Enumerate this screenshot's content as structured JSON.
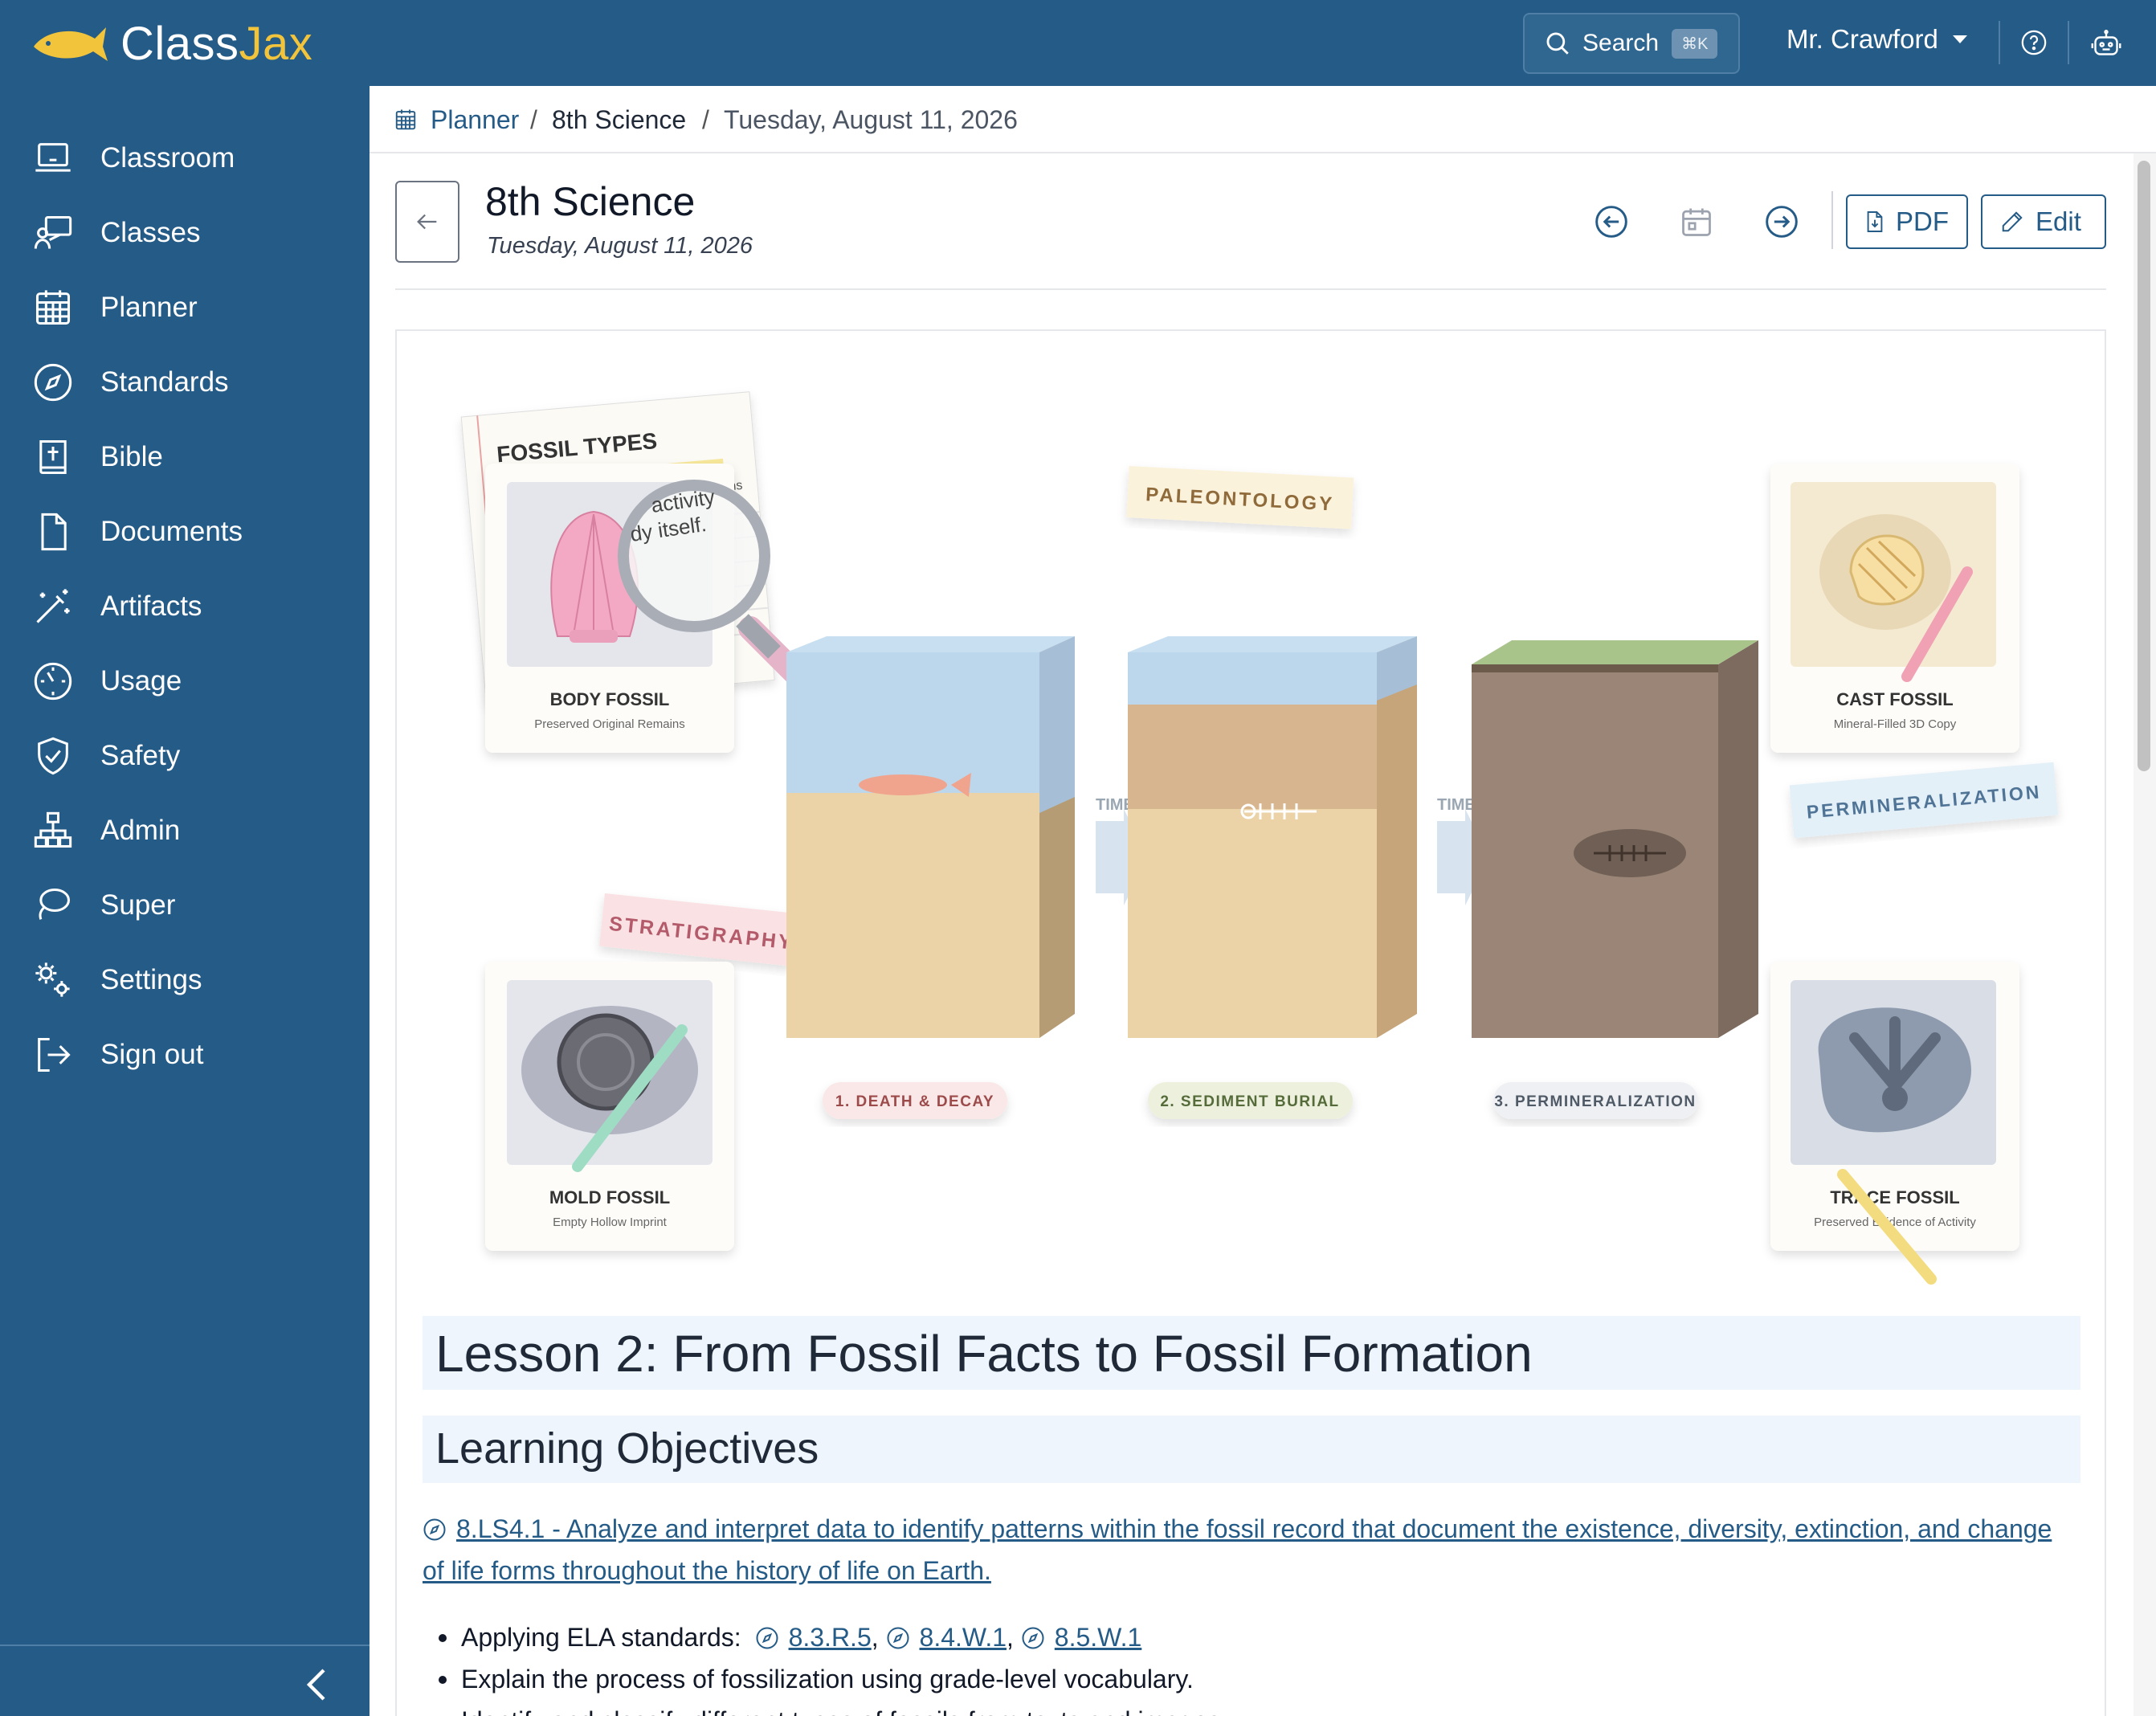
{
  "app": {
    "logo_text_main": "Class",
    "logo_text_accent": "Jax",
    "brand_color": "#255b87",
    "accent_color": "#f2c43b"
  },
  "topbar": {
    "search_label": "Search",
    "search_shortcut": "⌘K",
    "user_name": "Mr. Crawford"
  },
  "sidebar": {
    "items": [
      {
        "label": "Classroom",
        "icon": "laptop-icon"
      },
      {
        "label": "Classes",
        "icon": "teacher-board-icon"
      },
      {
        "label": "Planner",
        "icon": "calendar-grid-icon"
      },
      {
        "label": "Standards",
        "icon": "compass-icon"
      },
      {
        "label": "Bible",
        "icon": "bible-icon"
      },
      {
        "label": "Documents",
        "icon": "document-icon"
      },
      {
        "label": "Artifacts",
        "icon": "magic-wand-icon"
      },
      {
        "label": "Usage",
        "icon": "gauge-icon"
      },
      {
        "label": "Safety",
        "icon": "shield-check-icon"
      },
      {
        "label": "Admin",
        "icon": "org-chart-icon"
      },
      {
        "label": "Super",
        "icon": "lasso-icon"
      },
      {
        "label": "Settings",
        "icon": "gears-icon"
      },
      {
        "label": "Sign out",
        "icon": "sign-out-icon"
      }
    ]
  },
  "breadcrumb": {
    "root": "Planner",
    "sep1": "/",
    "class_name": "8th Science",
    "sep2": "/",
    "date": "Tuesday, August 11, 2026"
  },
  "header": {
    "title": "8th Science",
    "subtitle": "Tuesday, August 11, 2026",
    "pdf_label": "PDF",
    "edit_label": "Edit"
  },
  "illustration": {
    "note_title": "FOSSIL TYPES",
    "magnifier_text_1": "activity",
    "magnifier_text_2": "dy itself.",
    "note_side_text": "ms",
    "tag_paleontology": "PALEONTOLOGY",
    "tag_stratigraphy": "STRATIGRAPHY",
    "tag_permineralization": "PERMINERALIZATION",
    "time_label_1": "TIME",
    "time_label_2": "TIME",
    "stage_1": "1. DEATH & DECAY",
    "stage_2": "2. SEDIMENT BURIAL",
    "stage_3": "3. PERMINERALIZATION",
    "cards": {
      "body": {
        "title": "BODY FOSSIL",
        "caption": "Preserved Original Remains"
      },
      "cast": {
        "title": "CAST FOSSIL",
        "caption": "Mineral-Filled 3D Copy"
      },
      "mold": {
        "title": "MOLD FOSSIL",
        "caption": "Empty Hollow Imprint"
      },
      "trace": {
        "title": "TRACE FOSSIL",
        "caption": "Preserved Evidence of Activity"
      }
    }
  },
  "lesson": {
    "title": "Lesson 2: From Fossil Facts to Fossil Formation",
    "objectives_heading": "Learning Objectives",
    "standard_link": "8.LS4.1 - Analyze and interpret data to identify patterns within the fossil record that document the existence, diversity, extinction, and change of life forms throughout the history of life on Earth.",
    "bullet_1_prefix": "Applying ELA standards:",
    "ela_links": [
      "8.3.R.5",
      "8.4.W.1",
      "8.5.W.1"
    ],
    "bullet_2": "Explain the process of fossilization using grade-level vocabulary.",
    "bullet_3": "Identify and classify different types of fossils from texts and images."
  }
}
